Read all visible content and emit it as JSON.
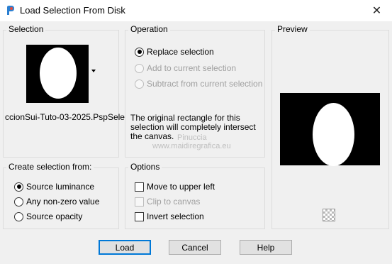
{
  "window": {
    "title": "Load Selection From Disk",
    "close_glyph": "✕"
  },
  "selection": {
    "label": "Selection",
    "filename": "ccionSui-Tuto-03-2025.PspSele"
  },
  "operation": {
    "label": "Operation",
    "options": [
      {
        "label": "Replace selection",
        "checked": true,
        "disabled": false
      },
      {
        "label": "Add to current selection",
        "checked": false,
        "disabled": true
      },
      {
        "label": "Subtract from current selection",
        "checked": false,
        "disabled": true
      }
    ],
    "info": "The original rectangle for this selection will completely intersect the canvas."
  },
  "preview": {
    "label": "Preview"
  },
  "create_from": {
    "label": "Create selection from:",
    "options": [
      {
        "label": "Source luminance",
        "checked": true
      },
      {
        "label": "Any non-zero value",
        "checked": false
      },
      {
        "label": "Source opacity",
        "checked": false
      }
    ]
  },
  "options": {
    "label": "Options",
    "items": [
      {
        "label": "Move to upper left",
        "checked": false,
        "disabled": false
      },
      {
        "label": "Clip to canvas",
        "checked": false,
        "disabled": true
      },
      {
        "label": "Invert selection",
        "checked": false,
        "disabled": false
      }
    ]
  },
  "buttons": {
    "load": "Load",
    "cancel": "Cancel",
    "help": "Help"
  },
  "watermark": {
    "line1": "Pinuccia",
    "line2": "www.maidiregrafica.eu"
  },
  "colors": {
    "accent": "#0078d7"
  }
}
